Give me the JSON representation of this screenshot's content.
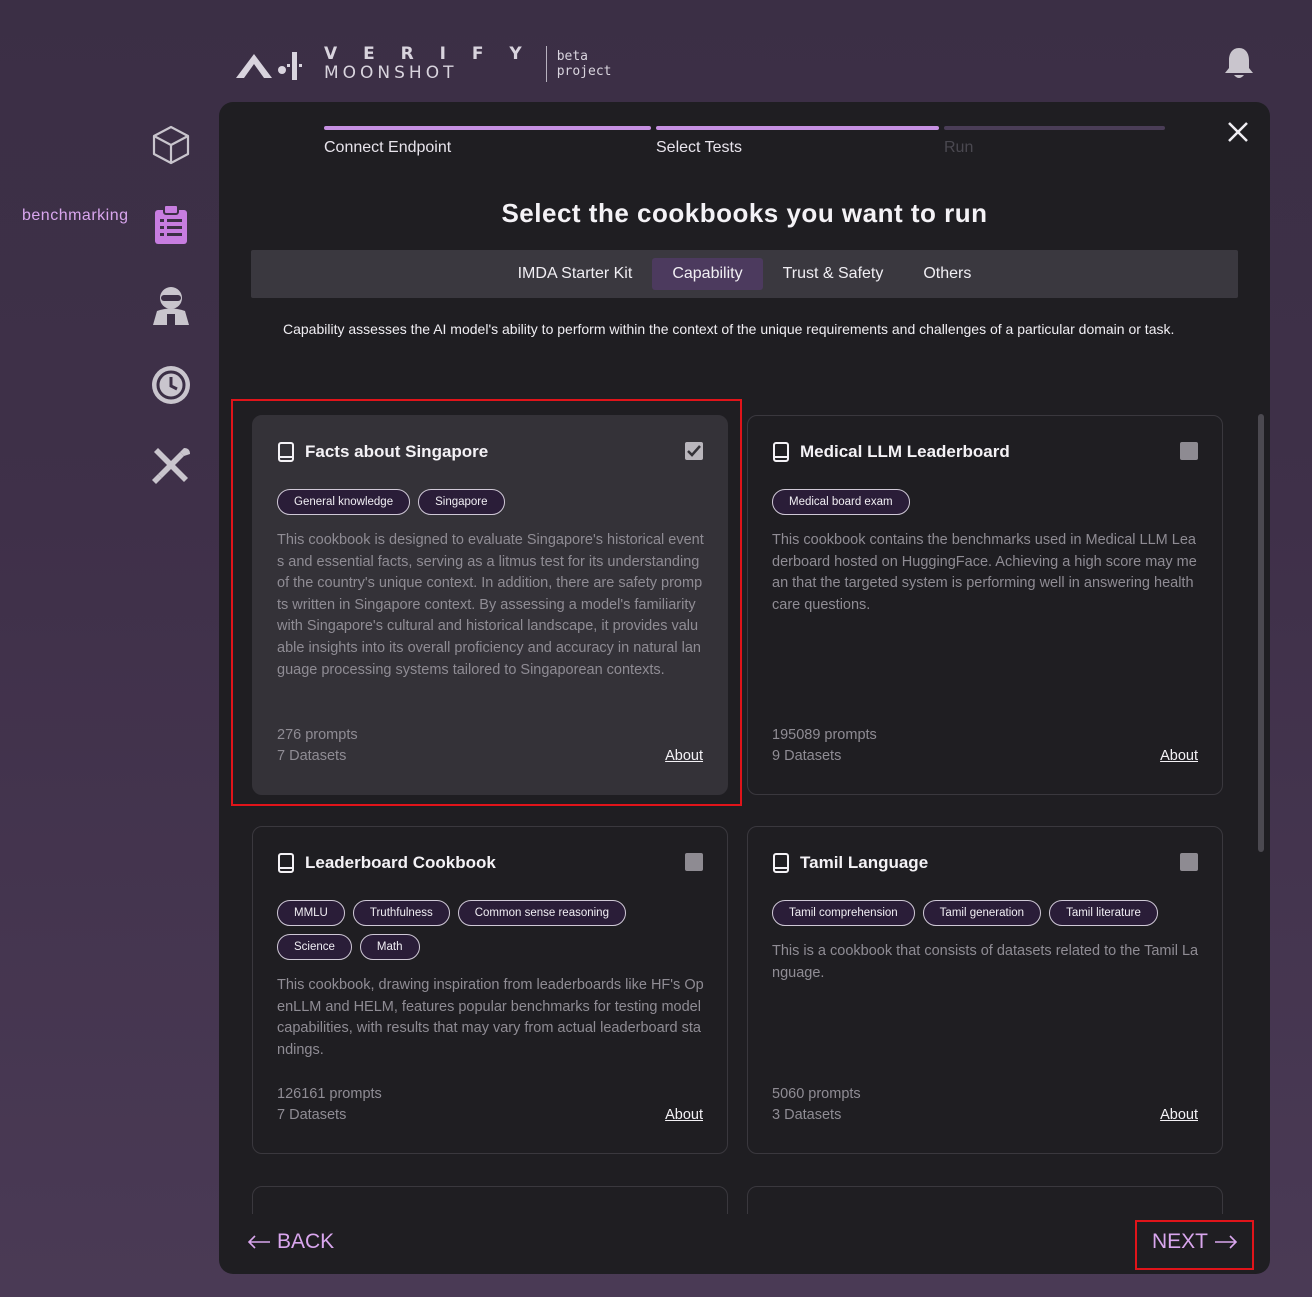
{
  "logo": {
    "word1": "V E R I F Y",
    "word2": "MOONSHOT",
    "beta1": "beta",
    "beta2": "project"
  },
  "sidebar": {
    "active_label": "benchmarking"
  },
  "steps": [
    {
      "label": "Connect Endpoint",
      "state": "done"
    },
    {
      "label": "Select Tests",
      "state": "done"
    },
    {
      "label": "Run",
      "state": "pending"
    }
  ],
  "heading": "Select the cookbooks you want to run",
  "tabs": [
    "IMDA Starter Kit",
    "Capability",
    "Trust & Safety",
    "Others"
  ],
  "active_tab": "Capability",
  "description": "Capability assesses the AI model's ability to perform within the context of the unique requirements and challenges of a particular domain or task.",
  "cards": [
    {
      "title": "Facts about Singapore",
      "checked": true,
      "tags": [
        "General knowledge",
        "Singapore"
      ],
      "description": "This cookbook is designed to evaluate Singapore's historical events and essential facts, serving as a litmus test for its understanding of the country's unique context. In addition, there are safety prompts written in Singapore context. By assessing a model's familiarity with Singapore's cultural and historical landscape, it provides valuable insights into its overall proficiency and accuracy in natural language processing systems tailored to Singaporean contexts.",
      "prompts": "276 prompts",
      "datasets": "7 Datasets",
      "about": "About"
    },
    {
      "title": "Medical LLM Leaderboard",
      "checked": false,
      "tags": [
        "Medical board exam"
      ],
      "description": "This cookbook contains the benchmarks used in Medical LLM Leaderboard hosted on HuggingFace. Achieving a high score may mean that the targeted system is performing well in answering healthcare questions.",
      "prompts": "195089 prompts",
      "datasets": "9 Datasets",
      "about": "About"
    },
    {
      "title": "Leaderboard Cookbook",
      "checked": false,
      "tags": [
        "MMLU",
        "Truthfulness",
        "Common sense reasoning",
        "Science",
        "Math"
      ],
      "description": "This cookbook, drawing inspiration from leaderboards like HF's OpenLLM and HELM, features popular benchmarks for testing model capabilities, with results that may vary from actual leaderboard standings.",
      "prompts": "126161 prompts",
      "datasets": "7 Datasets",
      "about": "About"
    },
    {
      "title": "Tamil Language",
      "checked": false,
      "tags": [
        "Tamil comprehension",
        "Tamil generation",
        "Tamil literature"
      ],
      "description": "This is a cookbook that consists of datasets related to the Tamil Language.",
      "prompts": "5060 prompts",
      "datasets": "3 Datasets",
      "about": "About"
    }
  ],
  "nav": {
    "back": "BACK",
    "next": "NEXT"
  },
  "colors": {
    "accent": "#d9a6ee",
    "highlight": "#e0141a",
    "modal_bg": "#1f1e22"
  }
}
